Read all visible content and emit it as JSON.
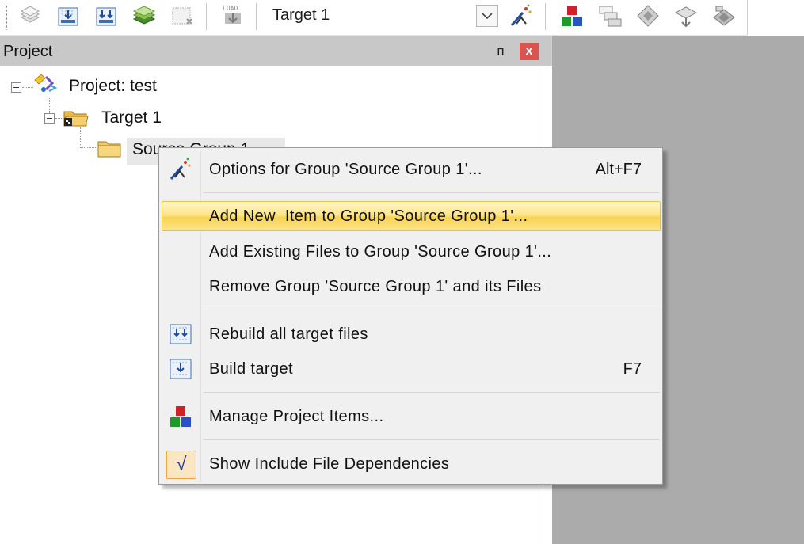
{
  "toolbar": {
    "target_selected": "Target 1",
    "buttons": [
      "translate-icon",
      "build-icon",
      "rebuild-icon",
      "batch-build-icon",
      "stop-build-icon",
      "download-icon",
      "options-for-target-icon",
      "manage-project-items-icon",
      "select-packs-icon",
      "manage-runtime-icon",
      "pack-installer-icon",
      "manage-multi-project-icon"
    ]
  },
  "project_pane": {
    "title": "Project",
    "pin_glyph": "ᴨ",
    "close_glyph": "x",
    "tree": {
      "root": "Project: test",
      "target": "Target 1",
      "group": "Source Group 1"
    }
  },
  "context_menu": {
    "items": [
      {
        "label": "Options for Group 'Source Group 1'...",
        "shortcut": "Alt+F7",
        "icon": "options-wand-icon"
      },
      {
        "label": "Add New  Item to Group 'Source Group 1'...",
        "shortcut": "",
        "icon": "",
        "highlighted": true
      },
      {
        "label": "Add Existing Files to Group 'Source Group 1'...",
        "shortcut": "",
        "icon": ""
      },
      {
        "label": "Remove Group 'Source Group 1' and its Files",
        "shortcut": "",
        "icon": ""
      },
      {
        "label": "Rebuild all target files",
        "shortcut": "",
        "icon": "rebuild-icon"
      },
      {
        "label": "Build target",
        "shortcut": "F7",
        "icon": "build-icon"
      },
      {
        "label": "Manage Project Items...",
        "shortcut": "",
        "icon": "manage-project-items-icon"
      },
      {
        "label": "Show Include File Dependencies",
        "shortcut": "",
        "icon": "checkmark-icon",
        "checked": true
      }
    ],
    "check_glyph": "√"
  },
  "colors": {
    "highlight": "#fbe38a",
    "close_button": "#d9534f",
    "pane_header": "#c8c8c8",
    "background_gray": "#ababab"
  }
}
